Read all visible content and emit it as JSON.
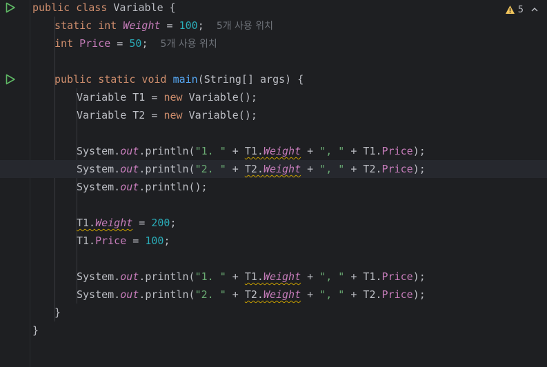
{
  "inspection": {
    "warning_count": "5"
  },
  "lines": [
    {
      "n": 1,
      "run": true,
      "indent": 0,
      "tokens": [
        {
          "t": "public class ",
          "c": "kw"
        },
        {
          "t": "Variable {"
        }
      ]
    },
    {
      "n": 2,
      "indent": 1,
      "tokens": [
        {
          "t": "static int ",
          "c": "kw"
        },
        {
          "t": "Weight",
          "c": "fld-i"
        },
        {
          "t": " = "
        },
        {
          "t": "100",
          "c": "num"
        },
        {
          "t": ";  "
        },
        {
          "t": "5개 사용 위치",
          "c": "hint"
        }
      ]
    },
    {
      "n": 3,
      "indent": 1,
      "tokens": [
        {
          "t": "int ",
          "c": "kw"
        },
        {
          "t": "Price",
          "c": "fld"
        },
        {
          "t": " = "
        },
        {
          "t": "50",
          "c": "num"
        },
        {
          "t": ";  "
        },
        {
          "t": "5개 사용 위치",
          "c": "hint"
        }
      ]
    },
    {
      "n": 4,
      "indent": 0,
      "tokens": []
    },
    {
      "n": 5,
      "run": true,
      "indent": 1,
      "tokens": [
        {
          "t": "public static void ",
          "c": "kw"
        },
        {
          "t": "main",
          "c": "fn"
        },
        {
          "t": "(String[] args) {"
        }
      ]
    },
    {
      "n": 6,
      "indent": 2,
      "tokens": [
        {
          "t": "Variable T1 = "
        },
        {
          "t": "new ",
          "c": "kw"
        },
        {
          "t": "Variable();"
        }
      ]
    },
    {
      "n": 7,
      "indent": 2,
      "tokens": [
        {
          "t": "Variable T2 = "
        },
        {
          "t": "new ",
          "c": "kw"
        },
        {
          "t": "Variable();"
        }
      ]
    },
    {
      "n": 8,
      "indent": 0,
      "tokens": []
    },
    {
      "n": 9,
      "indent": 2,
      "tokens": [
        {
          "t": "System."
        },
        {
          "t": "out",
          "c": "fld-i"
        },
        {
          "t": ".println("
        },
        {
          "t": "\"1. \"",
          "c": "str"
        },
        {
          "t": " + "
        },
        {
          "t": "T1.",
          "w": true
        },
        {
          "t": "Weight",
          "c": "fld-i",
          "w": true
        },
        {
          "t": " + "
        },
        {
          "t": "\", \"",
          "c": "str"
        },
        {
          "t": " + T1."
        },
        {
          "t": "Price",
          "c": "fld"
        },
        {
          "t": ");"
        }
      ]
    },
    {
      "n": 10,
      "current": true,
      "indent": 2,
      "tokens": [
        {
          "t": "System."
        },
        {
          "t": "out",
          "c": "fld-i"
        },
        {
          "t": ".println("
        },
        {
          "t": "\"2. \"",
          "c": "str"
        },
        {
          "t": " + "
        },
        {
          "t": "T2.",
          "w": true
        },
        {
          "t": "Weight",
          "c": "fld-i",
          "w": true
        },
        {
          "t": " + "
        },
        {
          "t": "\", \"",
          "c": "str"
        },
        {
          "t": " + T2."
        },
        {
          "t": "Price",
          "c": "fld"
        },
        {
          "t": ");"
        }
      ]
    },
    {
      "n": 11,
      "indent": 2,
      "tokens": [
        {
          "t": "System."
        },
        {
          "t": "out",
          "c": "fld-i"
        },
        {
          "t": ".println();"
        }
      ]
    },
    {
      "n": 12,
      "indent": 0,
      "tokens": []
    },
    {
      "n": 13,
      "indent": 2,
      "tokens": [
        {
          "t": "T1.",
          "w": true
        },
        {
          "t": "Weight",
          "c": "fld-i",
          "w": true
        },
        {
          "t": " = "
        },
        {
          "t": "200",
          "c": "num"
        },
        {
          "t": ";"
        }
      ]
    },
    {
      "n": 14,
      "indent": 2,
      "tokens": [
        {
          "t": "T1."
        },
        {
          "t": "Price",
          "c": "fld"
        },
        {
          "t": " = "
        },
        {
          "t": "100",
          "c": "num"
        },
        {
          "t": ";"
        }
      ]
    },
    {
      "n": 15,
      "indent": 0,
      "tokens": []
    },
    {
      "n": 16,
      "indent": 2,
      "tokens": [
        {
          "t": "System."
        },
        {
          "t": "out",
          "c": "fld-i"
        },
        {
          "t": ".println("
        },
        {
          "t": "\"1. \"",
          "c": "str"
        },
        {
          "t": " + "
        },
        {
          "t": "T1.",
          "w": true
        },
        {
          "t": "Weight",
          "c": "fld-i",
          "w": true
        },
        {
          "t": " + "
        },
        {
          "t": "\", \"",
          "c": "str"
        },
        {
          "t": " + T1."
        },
        {
          "t": "Price",
          "c": "fld"
        },
        {
          "t": ");"
        }
      ]
    },
    {
      "n": 17,
      "indent": 2,
      "tokens": [
        {
          "t": "System."
        },
        {
          "t": "out",
          "c": "fld-i"
        },
        {
          "t": ".println("
        },
        {
          "t": "\"2. \"",
          "c": "str"
        },
        {
          "t": " + "
        },
        {
          "t": "T2.",
          "w": true
        },
        {
          "t": "Weight",
          "c": "fld-i",
          "w": true
        },
        {
          "t": " + "
        },
        {
          "t": "\", \"",
          "c": "str"
        },
        {
          "t": " + T2."
        },
        {
          "t": "Price",
          "c": "fld"
        },
        {
          "t": ");"
        }
      ]
    },
    {
      "n": 18,
      "indent": 1,
      "tokens": [
        {
          "t": "}"
        }
      ]
    },
    {
      "n": 19,
      "indent": 0,
      "tokens": [
        {
          "t": "}"
        }
      ]
    }
  ],
  "colors": {
    "background": "#1e1f22",
    "current_line": "#26282e",
    "keyword": "#cf8e6d",
    "number": "#2aacb8",
    "string": "#6aab73",
    "field": "#c77dbb",
    "method": "#56a8f5",
    "hint": "#6f737a",
    "run_icon": "#5fb865",
    "warning_icon": "#f2c55c"
  },
  "icons": {
    "run": "run-gutter-icon",
    "warning": "warning-icon",
    "chevron": "chevron-up-icon"
  }
}
